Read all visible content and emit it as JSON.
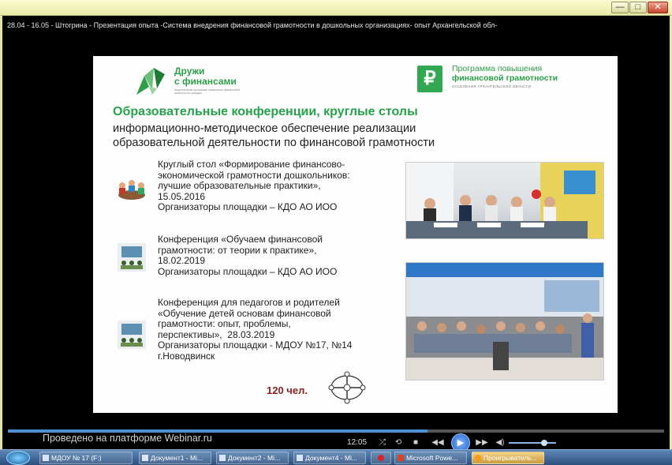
{
  "window": {
    "min_label": "—",
    "max_label": "□",
    "close_label": "✕"
  },
  "video_title": "28.04 - 16.05 - Штогрина - Презентация опыта -Система внедрения финансовой грамотности в дошкольных организациях- опыт Архангельской обл-",
  "slide": {
    "logo_left": {
      "text": "Дружи\nс финансами",
      "subtext": "национальная программа повышения финансовой грамотности граждан"
    },
    "logo_right": {
      "line1": "Программа повышения",
      "line2": "финансовой грамотности",
      "sub": "НАСЕЛЕНИЯ АРХАНГЕЛЬСКОЙ ОБЛАСТИ"
    },
    "heading": "Образовательные конференции, круглые столы",
    "subheading": "информационно-методическое обеспечение реализации образовательной деятельности по финансовой грамотности",
    "events": [
      "Круглый стол «Формирование финансово-\nэкономической грамотности дошкольников:\nлучшие образовательные практики»,\n15.05.2016\nОрганизаторы площадки – КДО АО ИОО",
      "Конференция «Обучаем финансовой\nграмотности: от теории к практике»,\n18.02.2019\nОрганизаторы площадки – КДО АО ИОО",
      "Конференция для педагогов и родителей\n«Обучение детей основам финансовой\nграмотности: опыт, проблемы,\nперспективы»,  28.03.2019\nОрганизаторы площадки - МДОУ №17, №14\nг.Новодвинск"
    ],
    "count": "120 чел."
  },
  "player": {
    "watermark": "Проведено на платформе Webinar.ru",
    "time": "12:05",
    "progress": 0.64,
    "volume": 0.75,
    "buttons": {
      "prev": "◀◀",
      "stop": "■",
      "play": "▶",
      "next": "▶▶",
      "mute": "◀)"
    }
  },
  "taskbar": {
    "tasks": [
      "МДОУ № 17 (F:)",
      "Документ1 - Mi...",
      "Документ2 - Mi...",
      "Документ4 - Mi...",
      "",
      "Microsoft Powe...",
      "Проигрыватель..."
    ]
  },
  "colors": {
    "brand_green": "#2d9f48",
    "heading_green": "#27a24c",
    "count_red": "#8a1f1f",
    "titlebar": "#fbfbd0"
  }
}
